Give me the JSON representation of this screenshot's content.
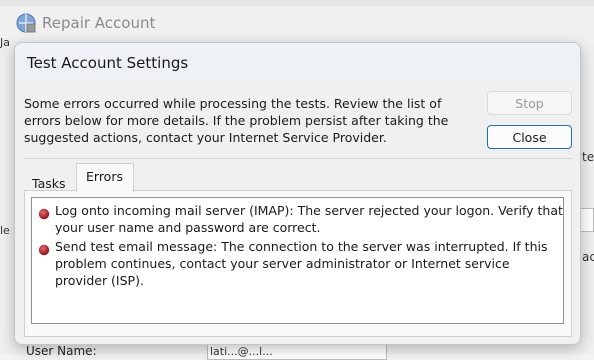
{
  "background": {
    "window_title": "Repair Account",
    "edge_left_1": "Ja",
    "edge_left_2": "",
    "edge_left_3": "le",
    "edge_right_1": "te",
    "edge_right_2": "ac",
    "user_name_label": "User Name:",
    "user_name_value": "lati...@...l..."
  },
  "dialog": {
    "title": "Test Account Settings",
    "message": "Some errors occurred while processing the tests. Review the list of errors below for more details. If the problem persist after taking the suggested actions, contact your Internet Service Provider.",
    "stop_label": "Stop",
    "close_label": "Close",
    "tabs": [
      {
        "label": "Tasks",
        "selected": false
      },
      {
        "label": "Errors",
        "selected": true
      }
    ],
    "errors": [
      {
        "icon": "error-icon",
        "text": "Log onto incoming mail server (IMAP): The server rejected your logon. Verify that your user name and password are correct."
      },
      {
        "icon": "error-icon",
        "text": "Send test email message: The connection to the server was interrupted. If this problem continues, contact your server administrator or Internet service provider (ISP)."
      }
    ]
  },
  "colors": {
    "accent": "#1f6fb8",
    "error": "#b00020"
  }
}
